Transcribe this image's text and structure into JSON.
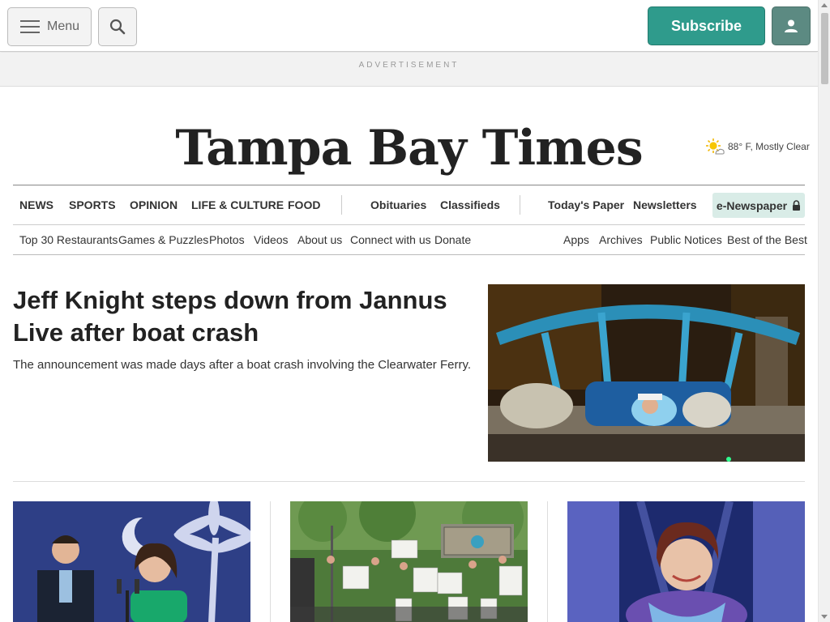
{
  "header": {
    "menu_label": "Menu",
    "subscribe_label": "Subscribe",
    "icons": [
      "hamburger-icon",
      "search-icon",
      "account-icon"
    ]
  },
  "ad": {
    "label": "ADVERTISEMENT"
  },
  "masthead": {
    "logo_text": "Tampa Bay Times",
    "weather": "88° F, Mostly Clear",
    "weather_icon": "sun-cloud-icon"
  },
  "nav_primary": {
    "items": [
      "NEWS",
      "SPORTS",
      "OPINION",
      "LIFE & CULTURE",
      "FOOD",
      "Obituaries",
      "Classifieds",
      "Today's Paper",
      "Newsletters"
    ],
    "enewspaper": "e-Newspaper"
  },
  "nav_secondary": {
    "items": [
      "Top 30 Restaurants",
      "Games & Puzzles",
      "Photos",
      "Videos",
      "About us",
      "Connect with us",
      "Donate",
      "Apps",
      "Archives",
      "Public Notices",
      "Best of the Best"
    ]
  },
  "lead": {
    "headline": "Jeff Knight steps down from Jannus Live after boat crash",
    "dek": "The announcement was made days after a boat crash involving the Clearwater Ferry."
  },
  "colors": {
    "accent": "#2f9b8c",
    "enews_bg": "#d9ece7"
  }
}
